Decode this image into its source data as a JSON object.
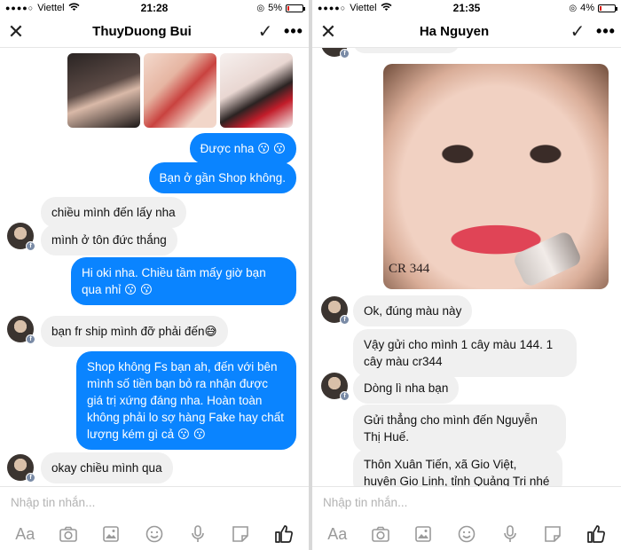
{
  "left": {
    "status": {
      "carrier": "Viettel",
      "time": "21:28",
      "battery": "5%"
    },
    "header": {
      "title": "ThuyDuong Bui",
      "close_icon": "close-icon",
      "check_icon": "check-icon",
      "more_icon": "more-icon"
    },
    "messages": [
      {
        "text": "Được nha 😗 😗"
      },
      {
        "text": "Bạn ở gần Shop không."
      },
      {
        "text": "chiều mình đến lấy nha"
      },
      {
        "text": "mình ở tôn đức thắng"
      },
      {
        "text": "Hi oki nha. Chiều tầm mấy giờ bạn qua nhỉ 😗 😗"
      },
      {
        "text": "bạn fr ship mình đỡ phải đến😅"
      },
      {
        "text": "Shop không Fs bạn ah, đến với bên mình số tiền bạn bỏ ra nhận được giá trị xứng đáng nha. Hoàn toàn không phải lo sợ hàng Fake hay chất lượng kém gì cả 😗 😗"
      },
      {
        "text": "okay chiều mình qua"
      }
    ],
    "composer": {
      "placeholder": "Nhập tin nhắn..."
    }
  },
  "right": {
    "status": {
      "carrier": "Viettel",
      "time": "21:35",
      "battery": "4%"
    },
    "header": {
      "title": "Ha Nguyen",
      "close_icon": "close-icon",
      "check_icon": "check-icon",
      "more_icon": "more-icon"
    },
    "photo_label": "CR 344",
    "messages": [
      {
        "text": "Ok, đúng màu này"
      },
      {
        "text": "Vậy gửi cho mình 1 cây màu 144. 1 cây màu cr344"
      },
      {
        "text": "Dòng lì nha bạn"
      },
      {
        "text": "Gửi thẳng cho mình đến Nguyễn Thị Huế."
      },
      {
        "text": "Thôn Xuân Tiến, xã Gio Việt, huyện Gio Linh, tỉnh Quảng Trị nhé"
      }
    ],
    "composer": {
      "placeholder": "Nhập tin nhắn..."
    }
  },
  "toolbar": {
    "text_label": "Aa",
    "icons": [
      "camera-icon",
      "gallery-icon",
      "emoji-icon",
      "microphone-icon",
      "sticker-icon",
      "like-icon"
    ]
  },
  "colors": {
    "outgoing_bubble": "#0a84ff",
    "incoming_bubble": "#f0f0f0"
  }
}
